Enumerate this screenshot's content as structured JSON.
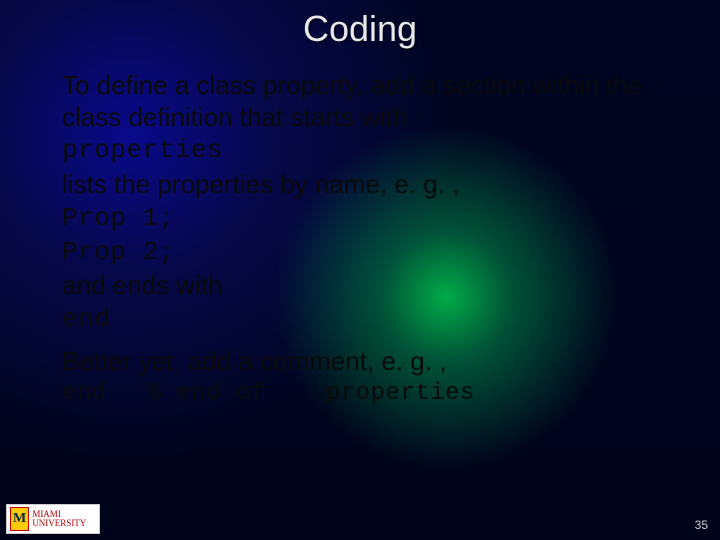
{
  "title": "Coding",
  "body": {
    "line1": "To define a class property, add a section within the class definition that starts with",
    "kw_properties": "properties",
    "line2": "lists the properties by name, e. g. ,",
    "prop1": "Prop 1;",
    "prop2": "Prop 2;",
    "line3": "and ends with",
    "kw_end": "end",
    "line4": "Better yet, add a comment, e. g. ,",
    "last_end": "end",
    "last_comment": "% end of",
    "last_kw": "properties"
  },
  "logo": {
    "letter": "M",
    "text": "MIAMI UNIVERSITY"
  },
  "page_number": "35"
}
